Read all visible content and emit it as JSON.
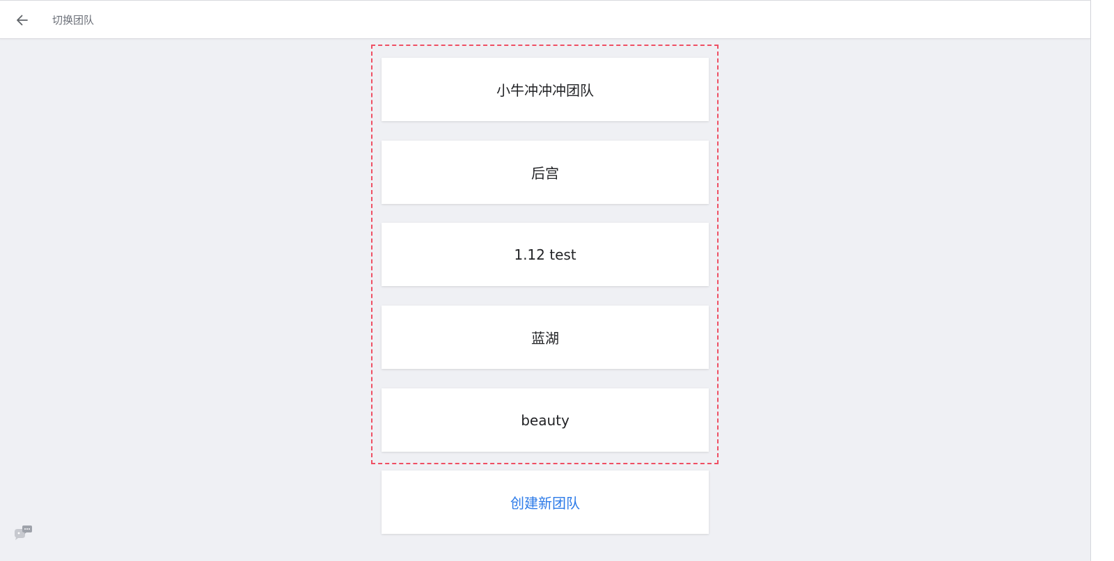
{
  "header": {
    "title": "切换团队",
    "back_icon": "arrow-left-icon"
  },
  "teams": [
    {
      "name": "小牛冲冲冲团队"
    },
    {
      "name": "后宫"
    },
    {
      "name": "1.12 test"
    },
    {
      "name": "蓝湖"
    },
    {
      "name": "beauty"
    }
  ],
  "create_team": {
    "label": "创建新团队"
  },
  "colors": {
    "accent": "#2d7be8",
    "highlight_border": "#ef4f63",
    "background": "#eff0f4"
  },
  "float_button": {
    "icon": "chat-bubble-icon"
  }
}
